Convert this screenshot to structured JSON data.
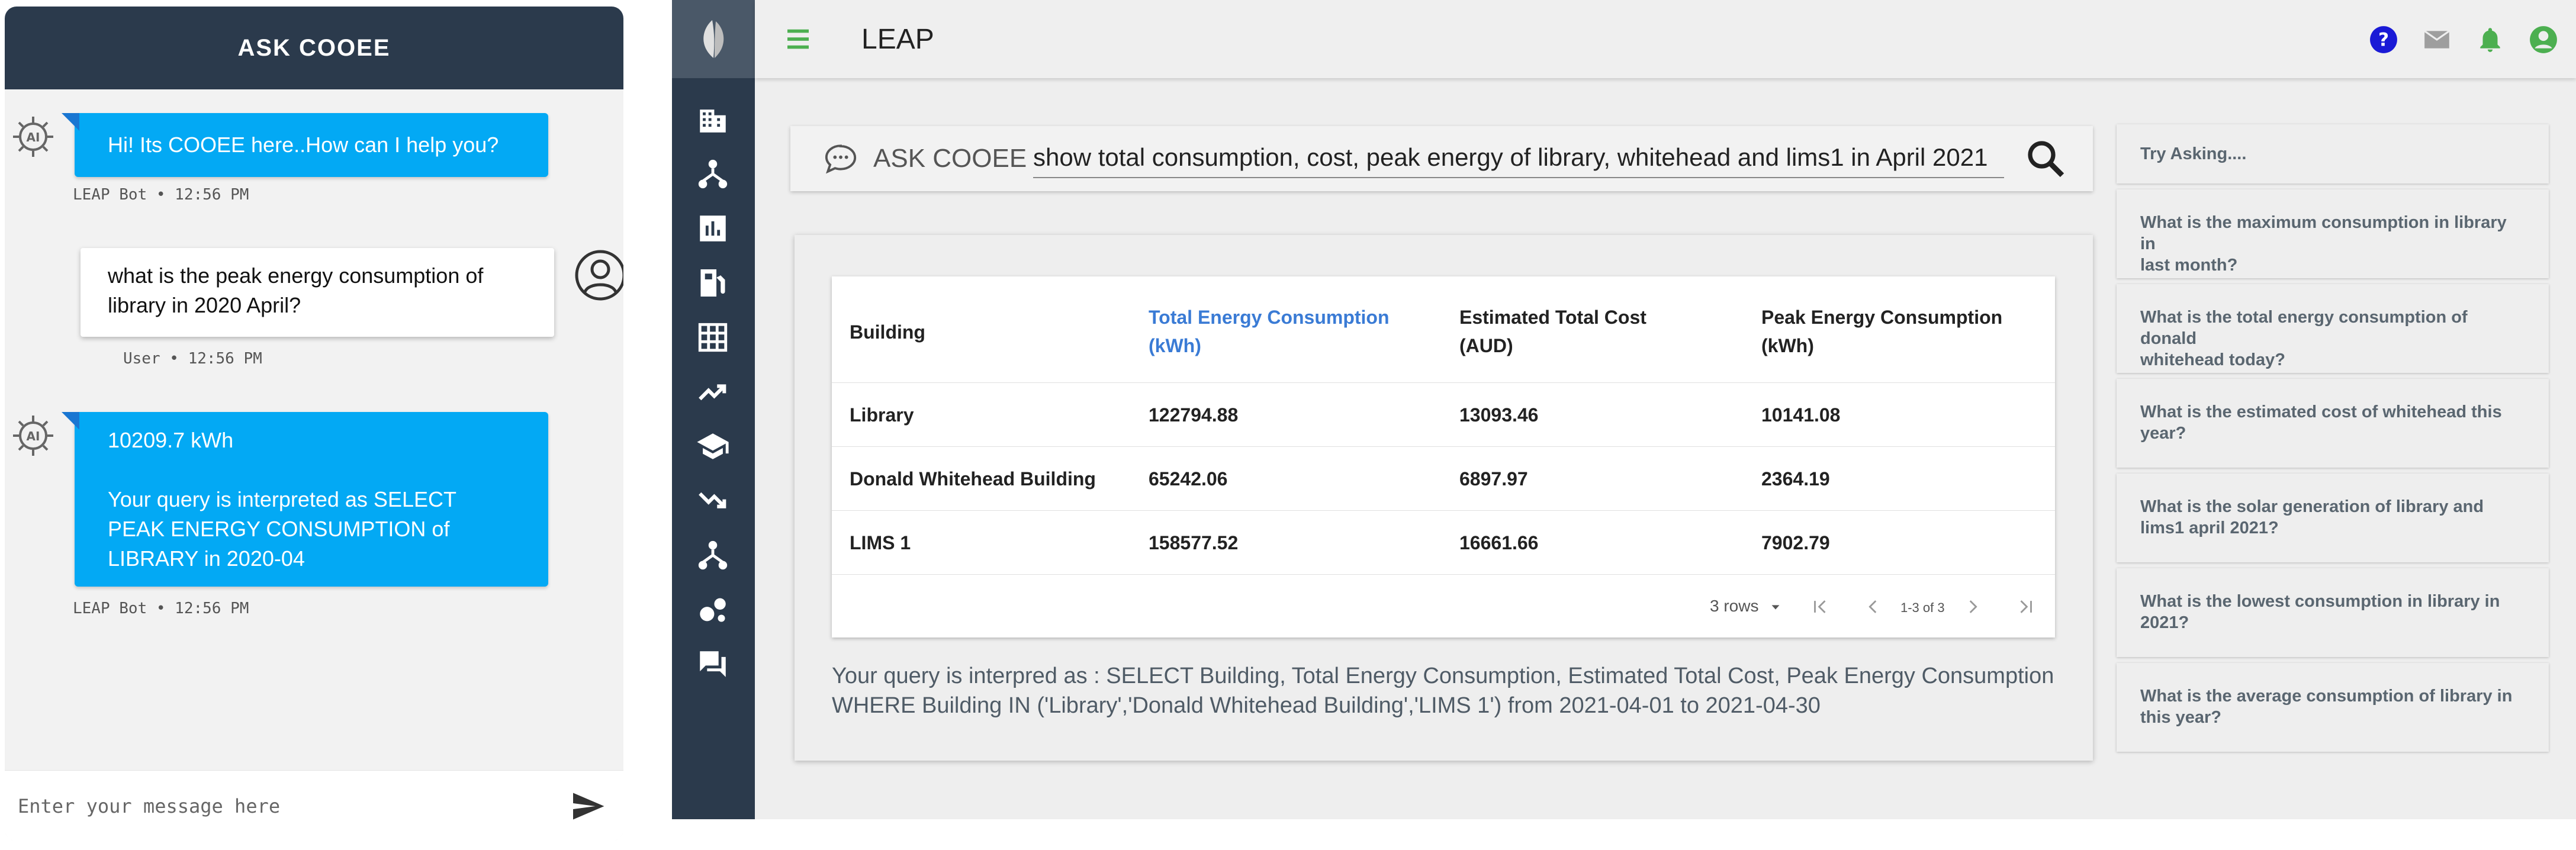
{
  "chat": {
    "title": "ASK COOEE",
    "messages": [
      {
        "sender": "bot",
        "text": "Hi! Its COOEE here..How can I help you?",
        "meta": "LEAP Bot • 12:56 PM"
      },
      {
        "sender": "user",
        "lines": [
          "what is the peak energy consumption of",
          "library in 2020 April?"
        ],
        "meta": "User • 12:56 PM"
      },
      {
        "sender": "bot",
        "lines": [
          "10209.7 kWh",
          "",
          "Your query is interpreted as SELECT",
          "PEAK ENERGY CONSUMPTION of",
          "LIBRARY in 2020-04"
        ],
        "meta": "LEAP Bot • 12:56 PM"
      }
    ],
    "input_placeholder": "Enter your message here"
  },
  "app": {
    "title": "LEAP",
    "ask_label": "ASK COOEE",
    "query": "show total consumption, cost, peak energy of library, whitehead and lims1 in April 2021",
    "table": {
      "headers": [
        [
          "Building"
        ],
        [
          "Total Energy Consumption",
          "(kWh)"
        ],
        [
          "Estimated Total Cost",
          "(AUD)"
        ],
        [
          "Peak Energy Consumption",
          "(kWh)"
        ]
      ],
      "rows": [
        [
          "Library",
          "122794.88",
          "13093.46",
          "10141.08"
        ],
        [
          "Donald Whitehead Building",
          "65242.06",
          "6897.97",
          "2364.19"
        ],
        [
          "LIMS 1",
          "158577.52",
          "16661.66",
          "7902.79"
        ]
      ],
      "rows_per_page": "3 rows",
      "page_info": "1-3 of 3"
    },
    "interpretation": [
      "Your query is interpred as : SELECT Building, Total Energy Consumption, Estimated Total Cost, Peak Energy Consumption",
      "WHERE Building IN ('Library','Donald Whitehead Building','LIMS 1') from 2021-04-01 to 2021-04-30"
    ],
    "try_asking": {
      "title": "Try Asking....",
      "items": [
        [
          "What is the maximum consumption in library in",
          "last month?"
        ],
        [
          "What is the total energy consumption of donald",
          "whitehead today?"
        ],
        [
          "What is the estimated cost of whitehead this",
          "year?"
        ],
        [
          "What is the solar generation of library and",
          "lims1 april 2021?"
        ],
        [
          "What is the lowest consumption in library in",
          "2021?"
        ],
        [
          "What is the average consumption of library in",
          "this year?"
        ]
      ]
    },
    "icons": {
      "sidebar": [
        "building-icon",
        "hierarchy-icon",
        "bar-chart-icon",
        "fuel-pump-icon",
        "grid-icon",
        "trending-up-icon",
        "school-icon",
        "trending-down-icon",
        "hierarchy-icon",
        "bubble-chart-icon",
        "forum-icon"
      ],
      "topbar": [
        "help-icon",
        "mail-icon",
        "bell-icon",
        "account-icon"
      ]
    },
    "colors": {
      "sidebar": "#2b3a4c",
      "accent_green": "#4caf50",
      "help_blue": "#1a1ad6",
      "bubble_blue": "#03a9f4",
      "header_blue": "#3a7bd5"
    }
  }
}
